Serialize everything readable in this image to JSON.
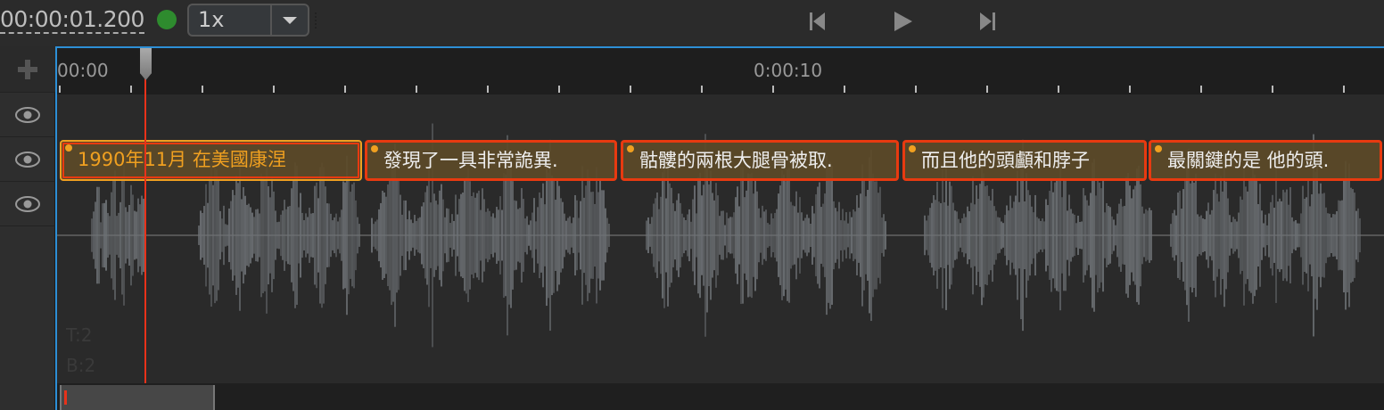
{
  "toolbar": {
    "current_time": "00:00:01.200",
    "status_color": "#2e8b2e",
    "speed": "1x",
    "icons": [
      "skip-back-icon",
      "play-icon",
      "skip-forward-icon"
    ]
  },
  "track_headers": {
    "icons": [
      "add-icon",
      "eye-icon",
      "eye-icon",
      "eye-icon"
    ]
  },
  "ruler": {
    "labels": [
      "00:00",
      "0:00:10"
    ]
  },
  "playhead_seconds": 1.2,
  "clips": [
    {
      "text": "1990年11月 在美國康涅",
      "selected": true
    },
    {
      "text": "發現了一具非常詭異."
    },
    {
      "text": "骷髏的兩根大腿骨被取."
    },
    {
      "text": "而且他的頭顱和脖子"
    },
    {
      "text": "最關鍵的是 他的頭."
    }
  ],
  "overlay": {
    "t": "T:2",
    "b": "B:2"
  },
  "colors": {
    "accent": "#2d8fd6",
    "playhead": "#e8321a",
    "clip_border": "#e83a10",
    "selected": "#f0a020"
  }
}
